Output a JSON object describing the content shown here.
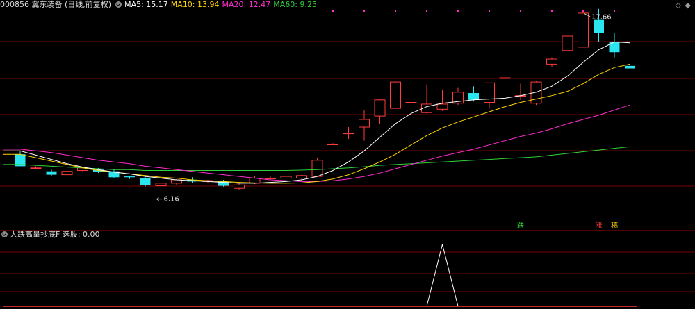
{
  "header": {
    "title": "000856 冀东装备 (日线,前复权)",
    "ma_labels": [
      {
        "text": "MA5: 15.17",
        "color": "#ffffff"
      },
      {
        "text": "MA10: 13.94",
        "color": "#ffd400"
      },
      {
        "text": "MA20: 12.47",
        "color": "#ff2ccd"
      },
      {
        "text": "MA60: 9.25",
        "color": "#2fd23a"
      }
    ],
    "controls": {
      "prev": "◇",
      "next": "◆"
    }
  },
  "indicator": {
    "title": "大跌高量抄底F",
    "value_label": "选股: 0.00"
  },
  "annotations": {
    "high_label": "17.66",
    "low_label": "6.16",
    "signals": [
      {
        "text": "跌",
        "color": "#2fd23a",
        "index": 32
      },
      {
        "text": "涨",
        "color": "#ff3b3b",
        "index": 37
      },
      {
        "text": "稿",
        "color": "#ffd400",
        "index": 38
      }
    ]
  },
  "colors": {
    "up": "#ff3b3b",
    "down": "#29e6f0",
    "ma5": "#ffffff",
    "ma10": "#ffd400",
    "ma20": "#ff2ccd",
    "ma60": "#2fd23a",
    "grid": "#7a0000",
    "signal": "#ffffff"
  },
  "chart_data": {
    "type": "candlestick",
    "ylim": [
      5.4,
      18.3
    ],
    "ohlc": [
      {
        "o": 9.8,
        "h": 10.0,
        "l": 9.1,
        "c": 9.1
      },
      {
        "o": 9.0,
        "h": 9.1,
        "l": 8.9,
        "c": 9.0
      },
      {
        "o": 8.8,
        "h": 8.9,
        "l": 8.5,
        "c": 8.6
      },
      {
        "o": 8.6,
        "h": 8.9,
        "l": 8.5,
        "c": 8.8
      },
      {
        "o": 8.85,
        "h": 9.0,
        "l": 8.75,
        "c": 9.0
      },
      {
        "o": 8.9,
        "h": 9.0,
        "l": 8.7,
        "c": 8.75
      },
      {
        "o": 8.8,
        "h": 8.9,
        "l": 8.4,
        "c": 8.45
      },
      {
        "o": 8.5,
        "h": 8.55,
        "l": 8.35,
        "c": 8.45
      },
      {
        "o": 8.4,
        "h": 8.5,
        "l": 7.9,
        "c": 8.0
      },
      {
        "o": 7.95,
        "h": 8.3,
        "l": 7.7,
        "c": 8.1
      },
      {
        "o": 8.1,
        "h": 8.35,
        "l": 8.0,
        "c": 8.3
      },
      {
        "o": 8.3,
        "h": 8.45,
        "l": 8.1,
        "c": 8.2
      },
      {
        "o": 8.2,
        "h": 8.3,
        "l": 8.1,
        "c": 8.25
      },
      {
        "o": 8.2,
        "h": 8.3,
        "l": 7.9,
        "c": 7.95
      },
      {
        "o": 7.8,
        "h": 8.1,
        "l": 7.7,
        "c": 8.0
      },
      {
        "o": 8.1,
        "h": 8.5,
        "l": 8.05,
        "c": 8.4
      },
      {
        "o": 8.4,
        "h": 8.5,
        "l": 8.3,
        "c": 8.4
      },
      {
        "o": 8.4,
        "h": 8.5,
        "l": 8.35,
        "c": 8.5
      },
      {
        "o": 8.4,
        "h": 8.6,
        "l": 8.3,
        "c": 8.55
      },
      {
        "o": 8.5,
        "h": 9.6,
        "l": 8.5,
        "c": 9.45
      },
      {
        "o": 10.4,
        "h": 10.45,
        "l": 10.35,
        "c": 10.4
      },
      {
        "o": 11.05,
        "h": 11.4,
        "l": 10.7,
        "c": 11.05
      },
      {
        "o": 11.4,
        "h": 12.4,
        "l": 10.6,
        "c": 11.85
      },
      {
        "o": 12.05,
        "h": 13.05,
        "l": 11.6,
        "c": 13.0
      },
      {
        "o": 12.5,
        "h": 14.1,
        "l": 12.5,
        "c": 14.05
      },
      {
        "o": 12.85,
        "h": 12.95,
        "l": 12.75,
        "c": 12.85
      },
      {
        "o": 12.25,
        "h": 13.9,
        "l": 12.2,
        "c": 12.75
      },
      {
        "o": 12.45,
        "h": 13.6,
        "l": 12.35,
        "c": 12.75
      },
      {
        "o": 12.8,
        "h": 13.7,
        "l": 12.7,
        "c": 13.45
      },
      {
        "o": 13.4,
        "h": 13.8,
        "l": 12.9,
        "c": 13.0
      },
      {
        "o": 12.85,
        "h": 14.0,
        "l": 12.5,
        "c": 14.0
      },
      {
        "o": 14.3,
        "h": 15.2,
        "l": 14.1,
        "c": 14.3
      },
      {
        "o": 13.25,
        "h": 13.95,
        "l": 13.0,
        "c": 13.25
      },
      {
        "o": 12.8,
        "h": 14.1,
        "l": 12.7,
        "c": 14.05
      },
      {
        "o": 15.1,
        "h": 15.5,
        "l": 14.95,
        "c": 15.4
      },
      {
        "o": 15.9,
        "h": 16.75,
        "l": 15.9,
        "c": 16.75
      },
      {
        "o": 16.1,
        "h": 18.15,
        "l": 16.1,
        "c": 18.1
      },
      {
        "o": 17.7,
        "h": 18.35,
        "l": 16.4,
        "c": 16.95
      },
      {
        "o": 16.4,
        "h": 16.95,
        "l": 15.5,
        "c": 15.8
      },
      {
        "o": 15.0,
        "h": 15.95,
        "l": 14.7,
        "c": 14.85
      }
    ],
    "ma5": [
      10.0,
      9.75,
      9.5,
      9.25,
      9.05,
      8.9,
      8.75,
      8.65,
      8.5,
      8.4,
      8.3,
      8.25,
      8.2,
      8.15,
      8.1,
      8.1,
      8.15,
      8.2,
      8.3,
      8.5,
      8.85,
      9.35,
      10.0,
      10.8,
      11.6,
      12.2,
      12.6,
      12.8,
      12.9,
      13.0,
      13.05,
      13.1,
      13.25,
      13.45,
      13.8,
      14.4,
      15.2,
      15.95,
      16.4,
      16.35
    ],
    "ma10": [
      9.8,
      9.6,
      9.4,
      9.2,
      9.0,
      8.85,
      8.75,
      8.65,
      8.55,
      8.45,
      8.4,
      8.3,
      8.25,
      8.2,
      8.15,
      8.12,
      8.1,
      8.1,
      8.12,
      8.2,
      8.35,
      8.6,
      8.95,
      9.35,
      9.8,
      10.35,
      10.9,
      11.35,
      11.7,
      12.0,
      12.3,
      12.6,
      12.85,
      13.05,
      13.25,
      13.5,
      13.95,
      14.5,
      14.9,
      15.1
    ],
    "ma20": [
      10.1,
      10.0,
      9.9,
      9.75,
      9.6,
      9.45,
      9.35,
      9.25,
      9.1,
      9.0,
      8.9,
      8.8,
      8.7,
      8.6,
      8.5,
      8.4,
      8.3,
      8.25,
      8.2,
      8.2,
      8.25,
      8.35,
      8.5,
      8.7,
      8.95,
      9.2,
      9.45,
      9.7,
      9.9,
      10.1,
      10.35,
      10.6,
      10.85,
      11.05,
      11.3,
      11.6,
      11.85,
      12.1,
      12.4,
      12.7
    ],
    "ma60": [
      9.2,
      9.15,
      9.1,
      9.05,
      9.0,
      8.95,
      8.9,
      8.9,
      8.85,
      8.85,
      8.85,
      8.85,
      8.85,
      8.85,
      8.85,
      8.85,
      8.85,
      8.85,
      8.87,
      8.9,
      8.95,
      9.0,
      9.07,
      9.15,
      9.2,
      9.25,
      9.3,
      9.35,
      9.4,
      9.45,
      9.5,
      9.55,
      9.6,
      9.65,
      9.75,
      9.85,
      9.95,
      10.05,
      10.15,
      10.25
    ],
    "signal_series": [
      0,
      0,
      0,
      0,
      0,
      0,
      0,
      0,
      0,
      0,
      0,
      0,
      0,
      0,
      0,
      0,
      0,
      0,
      0,
      0,
      0,
      0,
      0,
      0,
      0,
      0,
      0,
      1,
      0,
      0,
      0,
      0,
      0,
      0,
      0,
      0,
      0,
      0,
      0,
      0
    ]
  }
}
